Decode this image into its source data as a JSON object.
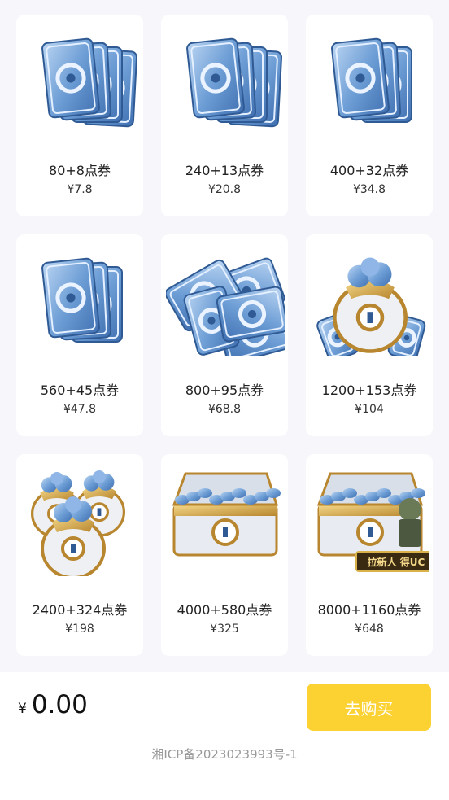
{
  "products": [
    {
      "name": "80+8点券",
      "price": "¥7.8",
      "art": "card-stack"
    },
    {
      "name": "240+13点券",
      "price": "¥20.8",
      "art": "card-stack"
    },
    {
      "name": "400+32点券",
      "price": "¥34.8",
      "art": "card-stack"
    },
    {
      "name": "560+45点券",
      "price": "¥47.8",
      "art": "card-stack"
    },
    {
      "name": "800+95点券",
      "price": "¥68.8",
      "art": "card-pile"
    },
    {
      "name": "1200+153点券",
      "price": "¥104",
      "art": "coin-bag"
    },
    {
      "name": "2400+324点券",
      "price": "¥198",
      "art": "coin-bags"
    },
    {
      "name": "4000+580点券",
      "price": "¥325",
      "art": "treasure-chest"
    },
    {
      "name": "8000+1160点券",
      "price": "¥648",
      "art": "treasure-chest-soldier"
    }
  ],
  "promo_badge": "拉新人 得UC",
  "footer": {
    "currency": "¥",
    "total": "0.00",
    "buy_label": "去购买",
    "icp": "湘ICP备2023023993号-1"
  },
  "colors": {
    "accent": "#fcd132",
    "background": "#f6f6fb",
    "card": "#ffffff"
  }
}
